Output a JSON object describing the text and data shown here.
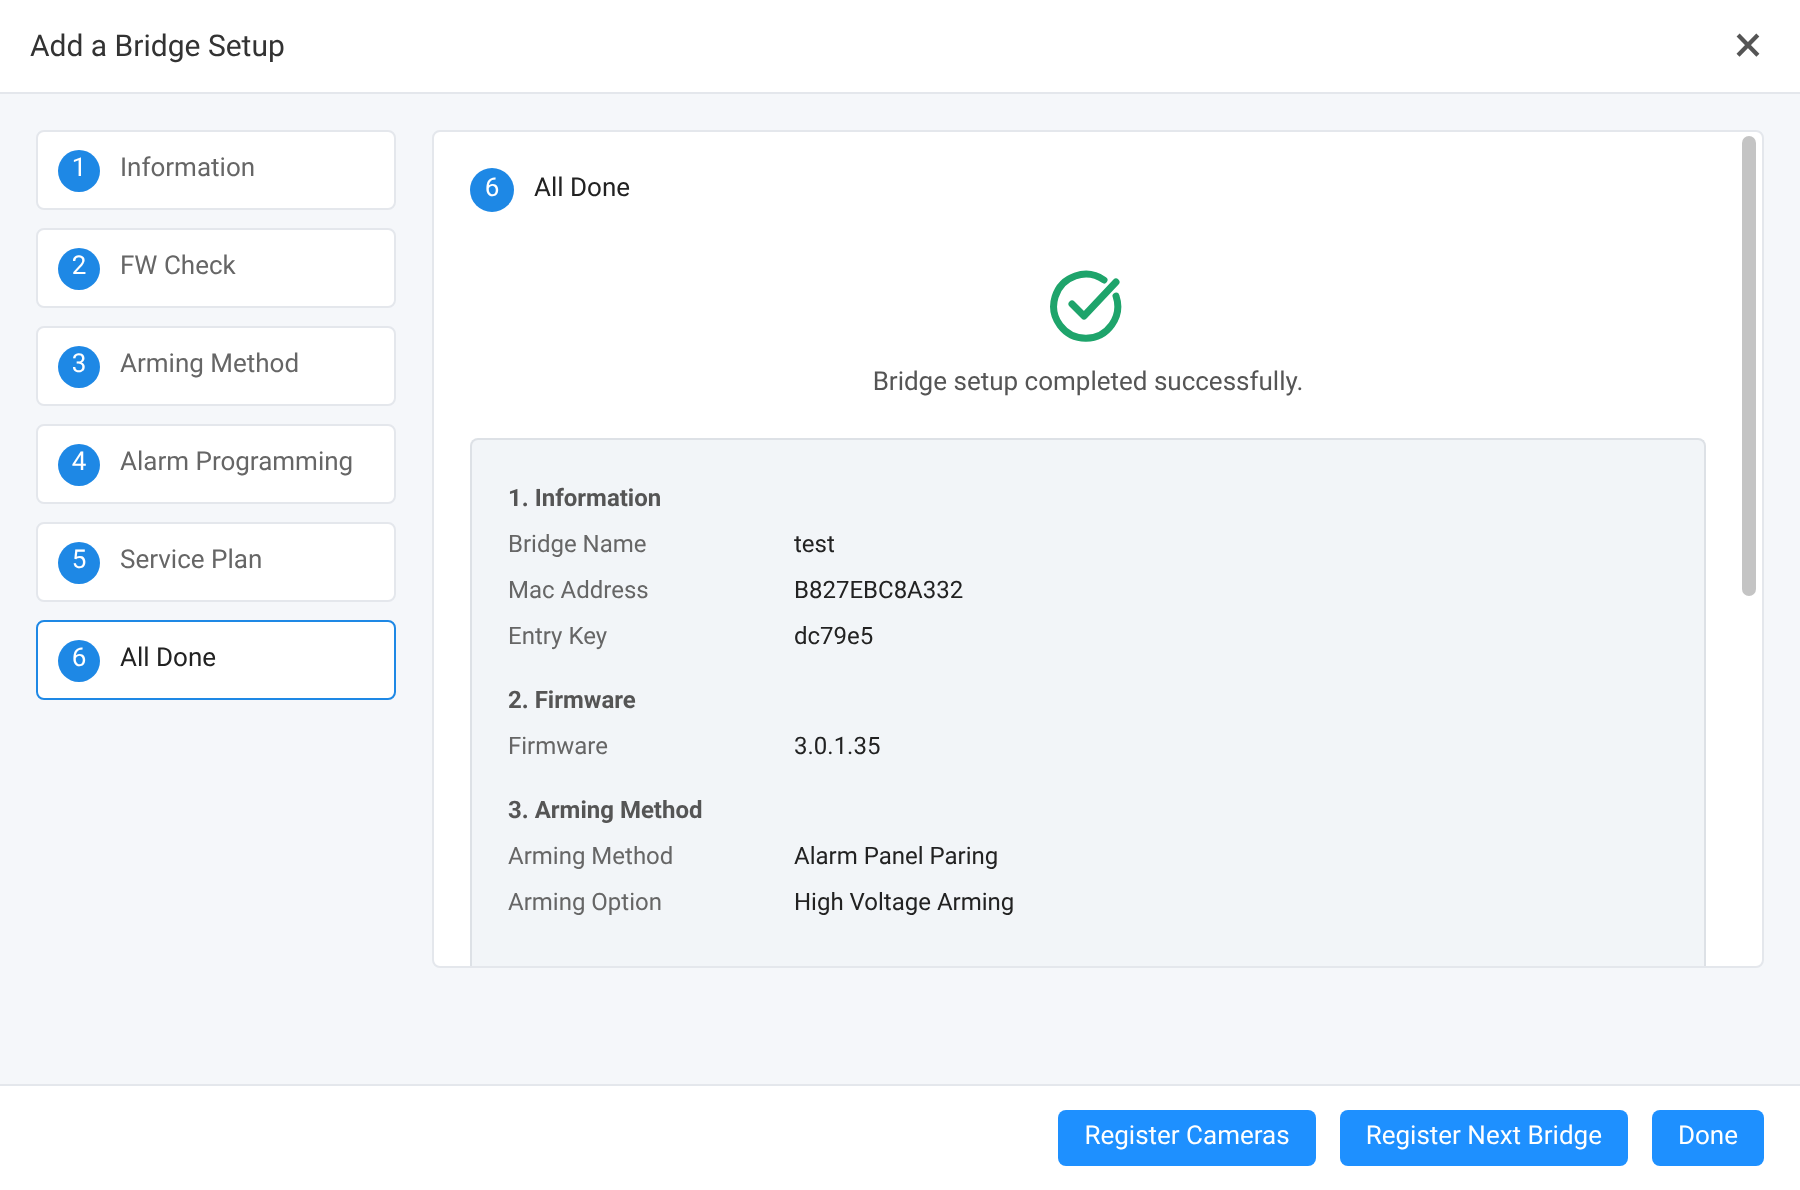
{
  "window": {
    "title": "Add a Bridge Setup",
    "close": "×"
  },
  "steps": [
    {
      "number": "1",
      "label": "Information",
      "selected": false
    },
    {
      "number": "2",
      "label": "FW Check",
      "selected": false
    },
    {
      "number": "3",
      "label": "Arming Method",
      "selected": false
    },
    {
      "number": "4",
      "label": "Alarm Programming",
      "selected": false
    },
    {
      "number": "5",
      "label": "Service Plan",
      "selected": false
    },
    {
      "number": "6",
      "label": "All Done",
      "selected": true
    }
  ],
  "panel": {
    "step_number": "6",
    "step_title": "All Done",
    "message": "Bridge setup completed successfully.",
    "sections": [
      {
        "title": "1. Information",
        "rows": [
          {
            "label": "Bridge Name",
            "value": "test"
          },
          {
            "label": "Mac Address",
            "value": "B827EBC8A332"
          },
          {
            "label": "Entry Key",
            "value": "dc79e5"
          }
        ]
      },
      {
        "title": "2. Firmware",
        "rows": [
          {
            "label": "Firmware",
            "value": "3.0.1.35"
          }
        ]
      },
      {
        "title": "3. Arming Method",
        "rows": [
          {
            "label": "Arming Method",
            "value": "Alarm Panel Paring"
          },
          {
            "label": "Arming Option",
            "value": "High Voltage Arming"
          }
        ]
      }
    ]
  },
  "buttons": [
    "Register Cameras",
    "Register Next Bridge",
    "Done"
  ]
}
